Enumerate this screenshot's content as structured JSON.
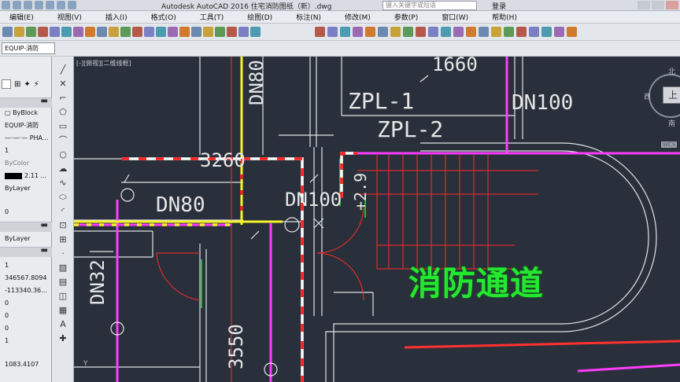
{
  "titlebar": {
    "title": "Autodesk AutoCAD 2016    住宅消防图纸（新）.dwg",
    "search_placeholder": "键入关键字或短语",
    "login": "登录"
  },
  "menu": [
    "编辑(E)",
    "视图(V)",
    "插入(I)",
    "格式(O)",
    "工具(T)",
    "绘图(D)",
    "标注(N)",
    "修改(M)",
    "参数(P)",
    "窗口(W)",
    "帮助(H)"
  ],
  "layer": {
    "current": "EQUIP-消防"
  },
  "properties": {
    "color": "ByBlock",
    "layer": "EQUIP-消防",
    "linetype": "—·—·— PHA...",
    "linetype_scale": "1",
    "plot_style": "ByColor",
    "lineweight": "2.11 ...",
    "transparency": "ByLayer",
    "thickness": "0",
    "material": "ByLayer",
    "pos_x": "1",
    "center_x": "346567.8094",
    "center_y": "-113340.36...",
    "center_z": "0",
    "v1": "0",
    "v2": "0",
    "v3": "1",
    "length": "1083.4107"
  },
  "drawing": {
    "viewport_label": "[-][俯视][二维线框]",
    "dims": {
      "d1660": "1660",
      "d3260": "3260",
      "d3550": "3550",
      "zpl1": "ZPL-1",
      "zpl2": "ZPL-2",
      "dn100_top": "DN100",
      "dn100_mid": "DN100",
      "dn80_h": "DN80",
      "dn80_v": "DN80",
      "dn32": "DN32",
      "plus29": "+2.9"
    },
    "stamp": "消防通道",
    "ucs_y": "Y"
  },
  "viewcube": {
    "face": "上",
    "north": "北",
    "west": "西",
    "south": "南",
    "wcs": "WCS"
  },
  "colors": {
    "canvas": "#2a303b",
    "magenta": "#ff3cff",
    "yellow": "#f5f52a",
    "red": "#ff2a2a",
    "white": "#ffffff",
    "green": "#24e830"
  }
}
